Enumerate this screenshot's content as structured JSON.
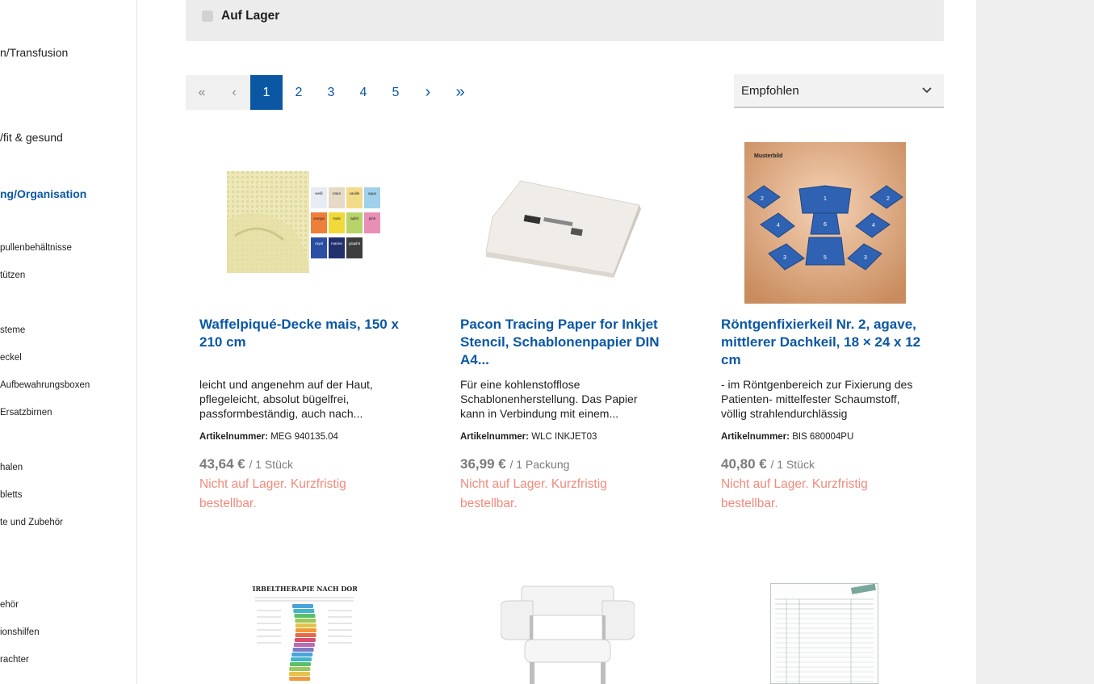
{
  "sidebar": {
    "items": [
      {
        "label": "n/Transfusion"
      },
      {
        "label": "/fit & gesund"
      },
      {
        "label": "ng/Organisation"
      },
      {
        "label": "pullenbehältnisse"
      },
      {
        "label": "tützen"
      },
      {
        "label": "steme"
      },
      {
        "label": "eckel"
      },
      {
        "label": " Aufbewahrungsboxen"
      },
      {
        "label": "Ersatzbirnen"
      },
      {
        "label": "halen"
      },
      {
        "label": "bletts"
      },
      {
        "label": "te und Zubehör"
      },
      {
        "label": "ehör"
      },
      {
        "label": "ionshilfen"
      },
      {
        "label": "rachter"
      }
    ]
  },
  "filter": {
    "label": "Auf Lager"
  },
  "pagination": {
    "first": "«",
    "prev": "‹",
    "next": "›",
    "last": "»",
    "pages": [
      "1",
      "2",
      "3",
      "4",
      "5"
    ],
    "current": "1"
  },
  "sort": {
    "selected": "Empfohlen"
  },
  "colors": {
    "accent": "#0b57a4",
    "stock": "#f08a7c",
    "price": "#7b7b7b"
  },
  "products": [
    {
      "title": "Waffelpiqué-Decke mais, 150 x 210 cm",
      "desc": "leicht und angenehm auf der Haut, pflegeleicht, absolut bügelfrei, passformbeständig, auch nach...",
      "art_label": "Artikelnummer:",
      "art": "MEG 940135.04",
      "price": "43,64 €",
      "unit": "/ 1 Stück",
      "stock": "Nicht auf Lager. Kurzfristig bestellbar.",
      "swatches": [
        "weiß",
        "natur",
        "vanille",
        "aqua",
        "orange",
        "mais",
        "apfel",
        "pink",
        "royal",
        "marine",
        "graphit"
      ]
    },
    {
      "title": "Pacon Tracing Paper for Inkjet Stencil, Schablonenpapier DIN A4...",
      "desc": "Für eine kohlenstofflose Schablonenherstellung. Das Papier kann in Verbindung mit einem...",
      "art_label": "Artikelnummer:",
      "art": "WLC INKJET03",
      "price": "36,99 €",
      "unit": "/ 1 Packung",
      "stock": "Nicht auf Lager. Kurzfristig bestellbar."
    },
    {
      "title": "Röntgenfixierkeil Nr. 2, agave, mittlerer Dachkeil, 18 × 24 x 12 cm",
      "desc": "- im Röntgenbereich zur Fixierung des Patienten- mittelfester Schaumstoff, völlig strahlendurchlässig",
      "art_label": "Artikelnummer:",
      "art": "BIS 680004PU",
      "price": "40,80 €",
      "unit": "/ 1 Stück",
      "stock": "Nicht auf Lager. Kurzfristig bestellbar.",
      "image_label": "Musterbild"
    }
  ],
  "row2": {
    "poster_title": "WIRBELTHERAPIE NACH DORN"
  }
}
